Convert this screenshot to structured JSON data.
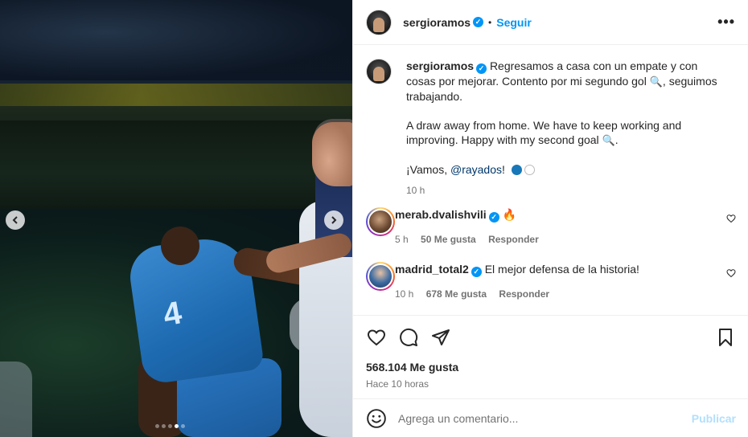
{
  "post": {
    "username": "sergioramos",
    "follow_label": "Seguir",
    "separator": "•",
    "more_label": "•••"
  },
  "caption": {
    "username": "sergioramos",
    "line1": "Regresamos a casa con un empate y con cosas por mejorar. Contento por mi segundo gol",
    "line1_end": ", seguimos trabajando.",
    "line2": "A draw away from home. We have to keep working and improving. Happy with my second goal",
    "line2_end": ".",
    "line3_pre": "¡Vamos,",
    "mention": "@rayados",
    "line3_post": "!",
    "emoji_goal": "🔍",
    "time": "10 h"
  },
  "comments": [
    {
      "username": "merab.dvalishvili",
      "text": "🔥",
      "time": "5 h",
      "likes": "50 Me gusta",
      "reply": "Responder"
    },
    {
      "username": "madrid_total2",
      "text": "El mejor defensa de la historia!",
      "time": "10 h",
      "likes": "678 Me gusta",
      "reply": "Responder"
    }
  ],
  "stats": {
    "likes": "568.104 Me gusta",
    "posted": "Hace 10 horas"
  },
  "add_comment": {
    "placeholder": "Agrega un comentario...",
    "post_label": "Publicar"
  },
  "carousel": {
    "prev_icon": "chevron-left-icon",
    "next_icon": "chevron-right-icon",
    "slides": 5,
    "active_slide": 4
  },
  "colors": {
    "accent": "#0095f6",
    "mention": "#00376b",
    "muted": "#737373",
    "post_disabled": "#b2dffc"
  }
}
